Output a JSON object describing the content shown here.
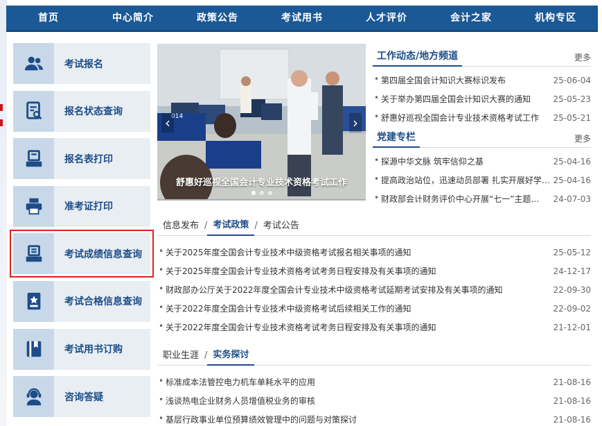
{
  "nav": [
    "首页",
    "中心简介",
    "政策公告",
    "考试用书",
    "人才评价",
    "会计之家",
    "机构专区"
  ],
  "left_menu": [
    {
      "label": "考试报名",
      "icon": "users-icon"
    },
    {
      "label": "报名状态查询",
      "icon": "document-search-icon"
    },
    {
      "label": "报名表打印",
      "icon": "print-tray-icon"
    },
    {
      "label": "准考证打印",
      "icon": "printer-icon"
    },
    {
      "label": "考试成绩信息查询",
      "icon": "inbox-icon"
    },
    {
      "label": "考试合格信息查询",
      "icon": "badge-icon"
    },
    {
      "label": "考试用书订购",
      "icon": "book-icon"
    },
    {
      "label": "咨询答疑",
      "icon": "support-agent-icon"
    }
  ],
  "carousel": {
    "caption": "舒惠好巡视全国会计专业技术资格考试工作",
    "screen_text": "014"
  },
  "work_news": {
    "title": "工作动态/地方频道",
    "more": "更多",
    "items": [
      {
        "title": "第四届全国会计知识大赛标识发布",
        "date": "25-06-04"
      },
      {
        "title": "关于举办第四届全国会计知识大赛的通知",
        "date": "25-05-23"
      },
      {
        "title": "舒惠好巡视全国会计专业技术资格考试工作",
        "date": "25-05-21"
      }
    ]
  },
  "party_news": {
    "title": "党建专栏",
    "more": "更多",
    "items": [
      {
        "title": "探源中华文脉 筑牢信仰之基",
        "date": "25-04-16"
      },
      {
        "title": "提高政治站位，迅速动员部署 扎实开展好学…",
        "date": "25-04-16"
      },
      {
        "title": "财政部会计财务评价中心开展“七一”主题…",
        "date": "24-07-03"
      }
    ]
  },
  "section1": {
    "tabs": [
      "信息发布",
      "考试政策",
      "考试公告"
    ],
    "separators": [
      "/",
      "/"
    ],
    "active_tab": "考试政策",
    "items": [
      {
        "title": "关于2025年度全国会计专业技术中级资格考试报名相关事项的通知",
        "date": "25-05-12"
      },
      {
        "title": "关于2025年度全国会计专业技术资格考试考务日程安排及有关事项的通知",
        "date": "24-12-17"
      },
      {
        "title": "财政部办公厅关于2022年度全国会计专业技术中级资格考试延期考试安排及有关事项的通知",
        "date": "22-09-30"
      },
      {
        "title": "关于2022年度全国会计专业技术中级资格考试后续相关工作的通知",
        "date": "22-09-02"
      },
      {
        "title": "关于2022年度全国会计专业技术资格考试考务日程安排及有关事项的通知",
        "date": "21-12-01"
      }
    ]
  },
  "section2": {
    "tabs": [
      "职业生涯",
      "实务探讨"
    ],
    "separators": [
      "/"
    ],
    "active_tab": "实务探讨",
    "items": [
      {
        "title": "标准成本法管控电力机车单耗水平的应用",
        "date": "21-08-16"
      },
      {
        "title": "浅谈热电企业财务人员增值税业务的审核",
        "date": "21-08-16"
      },
      {
        "title": "基层行政事业单位预算绩效管理中的问题与对策探讨",
        "date": "21-08-16"
      }
    ]
  },
  "colors": {
    "brand": "#1a5896",
    "accent": "#1d4d88",
    "highlight": "#e02020"
  }
}
